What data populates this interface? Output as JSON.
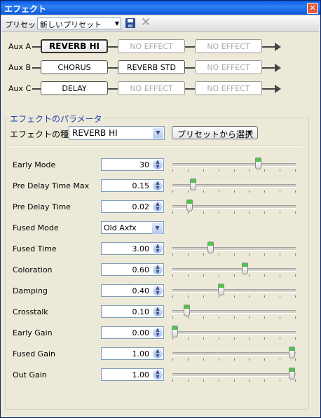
{
  "window": {
    "title": "エフェクト",
    "close_label": "✕"
  },
  "toolbar": {
    "preset_label": "プリセット",
    "preset_value": "新しいプリセット"
  },
  "aux_rows": [
    {
      "label": "Aux A",
      "slots": [
        {
          "text": "REVERB HI",
          "state": "active"
        },
        {
          "text": "NO EFFECT",
          "state": "disabled"
        },
        {
          "text": "NO EFFECT",
          "state": "disabled"
        }
      ]
    },
    {
      "label": "Aux B",
      "slots": [
        {
          "text": "CHORUS",
          "state": "normal"
        },
        {
          "text": "REVERB STD",
          "state": "normal"
        },
        {
          "text": "NO EFFECT",
          "state": "disabled"
        }
      ]
    },
    {
      "label": "Aux C",
      "slots": [
        {
          "text": "DELAY",
          "state": "normal"
        },
        {
          "text": "NO EFFECT",
          "state": "disabled"
        },
        {
          "text": "NO EFFECT",
          "state": "disabled"
        }
      ]
    }
  ],
  "params_group": {
    "title": "エフェクトのパラメータ",
    "effect_type_label": "エフェクトの種類",
    "effect_type_value": "REVERB HI",
    "from_preset_label": "プリセットから選択",
    "params": [
      {
        "label": "Early Mode",
        "value": "30",
        "slider": 0.7
      },
      {
        "label": "Pre Delay Time Max",
        "value": "0.15",
        "slider": 0.17
      },
      {
        "label": "Pre Delay Time",
        "value": "0.02",
        "slider": 0.14
      },
      {
        "label": "Fused Mode",
        "value": "Old Axfx",
        "slider": null
      },
      {
        "label": "Fused Time",
        "value": "3.00",
        "slider": 0.31
      },
      {
        "label": "Coloration",
        "value": "0.60",
        "slider": 0.59
      },
      {
        "label": "Damping",
        "value": "0.40",
        "slider": 0.4
      },
      {
        "label": "Crosstalk",
        "value": "0.10",
        "slider": 0.12
      },
      {
        "label": "Early Gain",
        "value": "0.00",
        "slider": 0.02
      },
      {
        "label": "Fused Gain",
        "value": "1.00",
        "slider": 0.97
      },
      {
        "label": "Out Gain",
        "value": "1.00",
        "slider": 0.97
      }
    ]
  }
}
